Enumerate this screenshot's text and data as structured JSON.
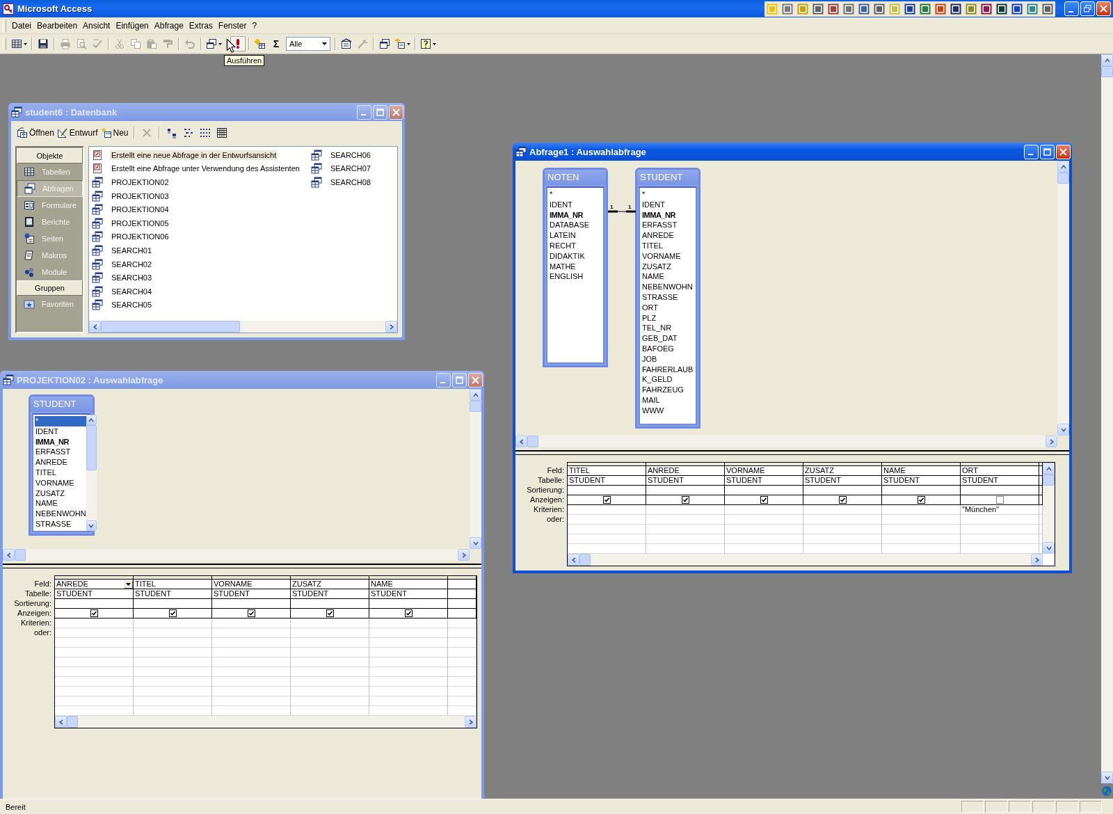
{
  "window": {
    "title": "Microsoft Access"
  },
  "menu": [
    "Datei",
    "Bearbeiten",
    "Ansicht",
    "Einfügen",
    "Abfrage",
    "Extras",
    "Fenster",
    "?"
  ],
  "toolbar": {
    "items": [
      {
        "kind": "view",
        "disabled": false
      },
      {
        "kind": "separator"
      },
      {
        "kind": "save",
        "disabled": false
      },
      {
        "kind": "separator"
      },
      {
        "kind": "print",
        "disabled": true
      },
      {
        "kind": "preview",
        "disabled": true
      },
      {
        "kind": "spelling",
        "disabled": true
      },
      {
        "kind": "separator"
      },
      {
        "kind": "cut",
        "disabled": true
      },
      {
        "kind": "copy",
        "disabled": true
      },
      {
        "kind": "paste",
        "disabled": true
      },
      {
        "kind": "painter",
        "disabled": true
      },
      {
        "kind": "separator"
      },
      {
        "kind": "undo",
        "disabled": true
      },
      {
        "kind": "separator"
      },
      {
        "kind": "querytype",
        "disabled": false
      },
      {
        "kind": "separator"
      },
      {
        "kind": "run",
        "disabled": false
      },
      {
        "kind": "separator"
      },
      {
        "kind": "showtable",
        "disabled": false
      },
      {
        "kind": "totals",
        "label": "Σ",
        "disabled": false
      },
      {
        "kind": "combo",
        "value": "Alle"
      },
      {
        "kind": "separator"
      },
      {
        "kind": "properties",
        "disabled": false
      },
      {
        "kind": "build",
        "disabled": true
      },
      {
        "kind": "separator"
      },
      {
        "kind": "dbwindow",
        "disabled": false
      },
      {
        "kind": "newobject",
        "disabled": false
      },
      {
        "kind": "separator"
      },
      {
        "kind": "help",
        "disabled": false
      }
    ],
    "tooltip": "Ausführen"
  },
  "database_window": {
    "title": "student6 : Datenbank",
    "active": false,
    "actions": [
      {
        "label": "Öffnen",
        "kind": "open"
      },
      {
        "label": "Entwurf",
        "kind": "design"
      },
      {
        "label": "Neu",
        "kind": "new"
      }
    ],
    "objects_header": "Objekte",
    "objects": [
      {
        "label": "Tabellen",
        "kind": "table",
        "selected": false
      },
      {
        "label": "Abfragen",
        "kind": "query",
        "selected": true
      },
      {
        "label": "Formulare",
        "kind": "form",
        "selected": false
      },
      {
        "label": "Berichte",
        "kind": "report",
        "selected": false
      },
      {
        "label": "Seiten",
        "kind": "page",
        "selected": false
      },
      {
        "label": "Makros",
        "kind": "macro",
        "selected": false
      },
      {
        "label": "Module",
        "kind": "module",
        "selected": false
      }
    ],
    "groups_header": "Gruppen",
    "groups": [
      {
        "label": "Favoriten",
        "selected": false
      }
    ],
    "items": [
      {
        "label": "Erstellt eine neue Abfrage in der Entwurfsansicht",
        "kind": "shortcut",
        "selected": true
      },
      {
        "label": "Erstellt eine Abfrage unter Verwendung des Assistenten",
        "kind": "shortcut",
        "selected": false
      },
      {
        "label": "PROJEKTION02",
        "kind": "query",
        "selected": false
      },
      {
        "label": "PROJEKTION03",
        "kind": "query",
        "selected": false
      },
      {
        "label": "PROJEKTION04",
        "kind": "query",
        "selected": false
      },
      {
        "label": "PROJEKTION05",
        "kind": "query",
        "selected": false
      },
      {
        "label": "PROJEKTION06",
        "kind": "query",
        "selected": false
      },
      {
        "label": "SEARCH01",
        "kind": "query",
        "selected": false
      },
      {
        "label": "SEARCH02",
        "kind": "query",
        "selected": false
      },
      {
        "label": "SEARCH03",
        "kind": "query",
        "selected": false
      },
      {
        "label": "SEARCH04",
        "kind": "query",
        "selected": false
      },
      {
        "label": "SEARCH05",
        "kind": "query",
        "selected": false
      },
      {
        "label": "SEARCH06",
        "kind": "query",
        "selected": false
      },
      {
        "label": "SEARCH07",
        "kind": "query",
        "selected": false
      },
      {
        "label": "SEARCH08",
        "kind": "query",
        "selected": false
      }
    ]
  },
  "query_windows": [
    {
      "title": "Abfrage1 : Auswahlabfrage",
      "active": true,
      "tables": [
        {
          "name": "NOTEN",
          "fields": [
            {
              "name": "*",
              "primary_key": false
            },
            {
              "name": "IDENT",
              "primary_key": false
            },
            {
              "name": "IMMA_NR",
              "primary_key": true
            },
            {
              "name": "DATABASE",
              "primary_key": false
            },
            {
              "name": "LATEIN",
              "primary_key": false
            },
            {
              "name": "RECHT",
              "primary_key": false
            },
            {
              "name": "DIDAKTIK",
              "primary_key": false
            },
            {
              "name": "MATHE",
              "primary_key": false
            },
            {
              "name": "ENGLISH",
              "primary_key": false
            }
          ]
        },
        {
          "name": "STUDENT",
          "fields": [
            {
              "name": "*",
              "primary_key": false
            },
            {
              "name": "IDENT",
              "primary_key": false
            },
            {
              "name": "IMMA_NR",
              "primary_key": true
            },
            {
              "name": "ERFASST",
              "primary_key": false
            },
            {
              "name": "ANREDE",
              "primary_key": false
            },
            {
              "name": "TITEL",
              "primary_key": false
            },
            {
              "name": "VORNAME",
              "primary_key": false
            },
            {
              "name": "ZUSATZ",
              "primary_key": false
            },
            {
              "name": "NAME",
              "primary_key": false
            },
            {
              "name": "NEBENWOHN",
              "primary_key": false
            },
            {
              "name": "STRASSE",
              "primary_key": false
            },
            {
              "name": "ORT",
              "primary_key": false
            },
            {
              "name": "PLZ",
              "primary_key": false
            },
            {
              "name": "TEL_NR",
              "primary_key": false
            },
            {
              "name": "GEB_DAT",
              "primary_key": false
            },
            {
              "name": "BAFOEG",
              "primary_key": false
            },
            {
              "name": "JOB",
              "primary_key": false
            },
            {
              "name": "FAHRERLAUB",
              "primary_key": false
            },
            {
              "name": "K_GELD",
              "primary_key": false
            },
            {
              "name": "FAHRZEUG",
              "primary_key": false
            },
            {
              "name": "MAIL",
              "primary_key": false
            },
            {
              "name": "WWW",
              "primary_key": false
            }
          ]
        }
      ],
      "relationship": {
        "from_label": "1",
        "to_label": "1"
      },
      "row_labels": [
        "Feld:",
        "Tabelle:",
        "Sortierung:",
        "Anzeigen:",
        "Kriterien:",
        "oder:"
      ],
      "columns": [
        {
          "field": "TITEL",
          "table": "STUDENT",
          "show": true,
          "selected": false
        },
        {
          "field": "ANREDE",
          "table": "STUDENT",
          "show": true,
          "selected": false
        },
        {
          "field": "VORNAME",
          "table": "STUDENT",
          "show": true,
          "selected": false
        },
        {
          "field": "ZUSATZ",
          "table": "STUDENT",
          "show": true,
          "selected": false
        },
        {
          "field": "NAME",
          "table": "STUDENT",
          "show": true,
          "selected": false
        },
        {
          "field": "ORT",
          "table": "STUDENT",
          "show": false,
          "criteria": "\"München\"",
          "selected": false
        }
      ]
    },
    {
      "title": "PROJEKTION02 : Auswahlabfrage",
      "active": false,
      "tables": [
        {
          "name": "STUDENT",
          "fields": [
            {
              "name": "*",
              "primary_key": false,
              "selected": true
            },
            {
              "name": "IDENT",
              "primary_key": false,
              "selected": false
            },
            {
              "name": "IMMA_NR",
              "primary_key": true,
              "selected": false
            },
            {
              "name": "ERFASST",
              "primary_key": false,
              "selected": false
            },
            {
              "name": "ANREDE",
              "primary_key": false,
              "selected": false
            },
            {
              "name": "TITEL",
              "primary_key": false,
              "selected": false
            },
            {
              "name": "VORNAME",
              "primary_key": false,
              "selected": false
            },
            {
              "name": "ZUSATZ",
              "primary_key": false,
              "selected": false
            },
            {
              "name": "NAME",
              "primary_key": false,
              "selected": false
            },
            {
              "name": "NEBENWOHN",
              "primary_key": false,
              "selected": false
            },
            {
              "name": "STRASSE",
              "primary_key": false,
              "selected": false
            }
          ]
        }
      ],
      "row_labels": [
        "Feld:",
        "Tabelle:",
        "Sortierung:",
        "Anzeigen:",
        "Kriterien:",
        "oder:"
      ],
      "columns": [
        {
          "field": "ANREDE",
          "table": "STUDENT",
          "show": true,
          "selected": true
        },
        {
          "field": "TITEL",
          "table": "STUDENT",
          "show": true,
          "selected": false
        },
        {
          "field": "VORNAME",
          "table": "STUDENT",
          "show": true,
          "selected": false
        },
        {
          "field": "ZUSATZ",
          "table": "STUDENT",
          "show": true,
          "selected": false
        },
        {
          "field": "NAME",
          "table": "STUDENT",
          "show": true,
          "selected": false
        }
      ]
    }
  ],
  "status_bar": {
    "text": "Bereit"
  }
}
